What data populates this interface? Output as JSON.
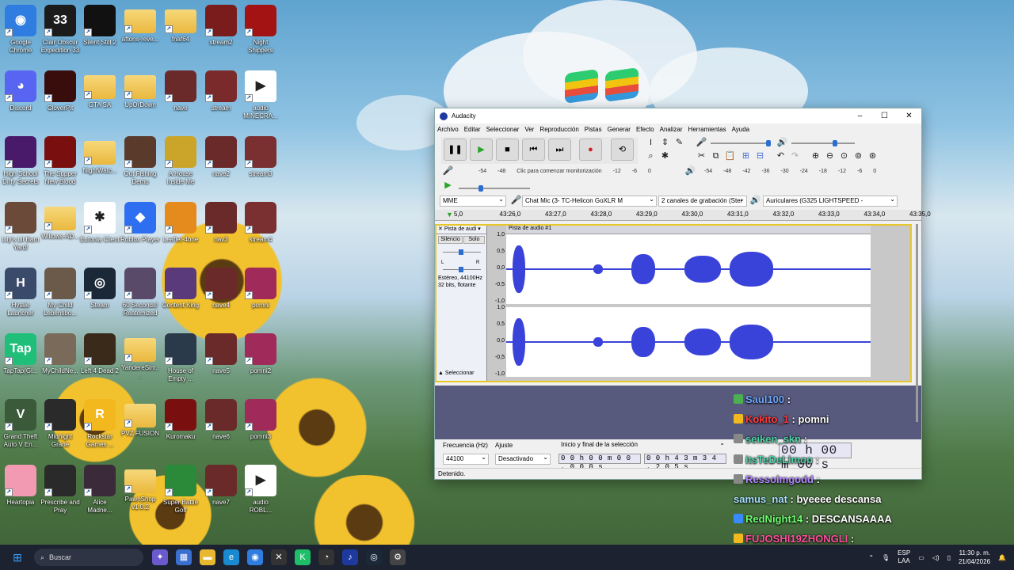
{
  "desktop": {
    "icons": [
      {
        "label": "Google Chrome",
        "color": "#2f7de1",
        "glyph": "◉"
      },
      {
        "label": "Clair Obscur Expedition 33",
        "color": "#1b1b1b",
        "glyph": "33"
      },
      {
        "label": "Silent Still 2",
        "color": "#111111",
        "glyph": ""
      },
      {
        "label": "aftons-reve...",
        "color": "folder",
        "glyph": ""
      },
      {
        "label": "fnaf64",
        "color": "folder",
        "glyph": ""
      },
      {
        "label": "stream2",
        "color": "#7a1c1c",
        "glyph": ""
      },
      {
        "label": "Night Shippers",
        "color": "#a31313",
        "glyph": ""
      },
      {
        "label": "Discord",
        "color": "#5865f2",
        "glyph": "◕"
      },
      {
        "label": "CloverPit",
        "color": "#3a0d0d",
        "glyph": ""
      },
      {
        "label": "GTA SA",
        "color": "folder",
        "glyph": ""
      },
      {
        "label": "UpOrDown",
        "color": "folder",
        "glyph": ""
      },
      {
        "label": "nave",
        "color": "#6b2a2a",
        "glyph": ""
      },
      {
        "label": "stream",
        "color": "#7a2a2a",
        "glyph": ""
      },
      {
        "label": "audio MINECRA...",
        "color": "#ffffff",
        "glyph": "▶"
      },
      {
        "label": "High School Dirty Secrets",
        "color": "#4a1a6a",
        "glyph": ""
      },
      {
        "label": "The Supper New Blood",
        "color": "#7a0f0f",
        "glyph": ""
      },
      {
        "label": "NightWatc...",
        "color": "folder",
        "glyph": ""
      },
      {
        "label": "Out Fishing Demo",
        "color": "#5a3a2a",
        "glyph": ""
      },
      {
        "label": "A House Inside Me",
        "color": "#caa52a",
        "glyph": ""
      },
      {
        "label": "nave2",
        "color": "#6b2a2a",
        "glyph": ""
      },
      {
        "label": "stream3",
        "color": "#7a3030",
        "glyph": ""
      },
      {
        "label": "Lily's Lil Barn Yard!",
        "color": "#6b4a3a",
        "glyph": ""
      },
      {
        "label": "Willows-AD...",
        "color": "folder",
        "glyph": ""
      },
      {
        "label": "Eufonia Client",
        "color": "#ffffff",
        "glyph": "✱"
      },
      {
        "label": "Roblox Player",
        "color": "#2e6ff2",
        "glyph": "◆"
      },
      {
        "label": "Leaflet-4one",
        "color": "#e58b1e",
        "glyph": ""
      },
      {
        "label": "nav3",
        "color": "#6b2a2a",
        "glyph": ""
      },
      {
        "label": "stream4",
        "color": "#7a3030",
        "glyph": ""
      },
      {
        "label": "Hytale Launcher",
        "color": "#3a4a6a",
        "glyph": "H"
      },
      {
        "label": "My Child Lebensbo...",
        "color": "#6b5a4a",
        "glyph": ""
      },
      {
        "label": "Steam",
        "color": "#1b2838",
        "glyph": "◎"
      },
      {
        "label": "60 Seconds! Reatomized",
        "color": "#5a4a6a",
        "glyph": ""
      },
      {
        "label": "Content King",
        "color": "#5a3a7a",
        "glyph": ""
      },
      {
        "label": "nave4",
        "color": "#6b2a2a",
        "glyph": ""
      },
      {
        "label": "pomni",
        "color": "#a02a5a",
        "glyph": ""
      },
      {
        "label": "TapTap(Gl...",
        "color": "#1fbf7a",
        "glyph": "Tap"
      },
      {
        "label": "MyChildNe...",
        "color": "#7a6a5a",
        "glyph": ""
      },
      {
        "label": "Left 4 Dead 2",
        "color": "#3a2a1a",
        "glyph": ""
      },
      {
        "label": "YandereSim...",
        "color": "folder",
        "glyph": ""
      },
      {
        "label": "House of Empty ...",
        "color": "#2a3a4a",
        "glyph": ""
      },
      {
        "label": "nave5",
        "color": "#6b2a2a",
        "glyph": ""
      },
      {
        "label": "pomni2",
        "color": "#a02a5a",
        "glyph": ""
      },
      {
        "label": "Grand Theft Auto V En...",
        "color": "#3a5a3a",
        "glyph": "V"
      },
      {
        "label": "Midnight Grane",
        "color": "#2a2a2a",
        "glyph": ""
      },
      {
        "label": "Rockstar Games ...",
        "color": "#f2b81e",
        "glyph": "R"
      },
      {
        "label": "PVZ FUSION",
        "color": "folder",
        "glyph": ""
      },
      {
        "label": "Kuromaku",
        "color": "#7a0f0f",
        "glyph": ""
      },
      {
        "label": "nave6",
        "color": "#6b2a2a",
        "glyph": ""
      },
      {
        "label": "pomni3",
        "color": "#a02a5a",
        "glyph": ""
      },
      {
        "label": "Heartopia",
        "color": "#f29ab2",
        "glyph": ""
      },
      {
        "label": "Prescribe and Pray",
        "color": "#2a2a2a",
        "glyph": ""
      },
      {
        "label": "Alice Madne...",
        "color": "#3a2a3a",
        "glyph": ""
      },
      {
        "label": "PawnShop v1.0.2",
        "color": "folder",
        "glyph": ""
      },
      {
        "label": "Super Battle Golf",
        "color": "#2a8a3a",
        "glyph": ""
      },
      {
        "label": "nave7",
        "color": "#6b2a2a",
        "glyph": ""
      },
      {
        "label": "audio ROBL...",
        "color": "#ffffff",
        "glyph": "▶"
      }
    ]
  },
  "window": {
    "title": "Audacity",
    "menus": [
      "Archivo",
      "Editar",
      "Seleccionar",
      "Ver",
      "Reproducción",
      "Pistas",
      "Generar",
      "Efecto",
      "Analizar",
      "Herramientas",
      "Ayuda"
    ],
    "rec_meter_ticks": [
      "-54",
      "-48",
      "-12",
      "-6",
      "0"
    ],
    "rec_meter_hint": "Clic para comenzar monitorización",
    "play_meter_ticks": [
      "-54",
      "-48",
      "-42",
      "-36",
      "-30",
      "-24",
      "-18",
      "-12",
      "-6",
      "0"
    ],
    "host": "MME",
    "rec_device": "Chat Mic (3- TC-Helicon GoXLR M",
    "channels": "2 canales de grabación (Ster",
    "play_device": "Auriculares (G325 LIGHTSPEED -",
    "ruler": [
      "5,0",
      "43:26,0",
      "43:27,0",
      "43:28,0",
      "43:29,0",
      "43:30,0",
      "43:31,0",
      "43:32,0",
      "43:33,0",
      "43:34,0",
      "43:35,0"
    ],
    "track": {
      "name": "Pista de audi",
      "clip": "Pista de audio #1",
      "mute": "Silencio",
      "solo": "Solo",
      "info1": "Estéreo, 44100Hz",
      "info2": "32 bits, flotante",
      "select": "Seleccionar",
      "gain_l": "L",
      "gain_r": "R",
      "vaxis": [
        "1,0",
        "0,5",
        "0,0",
        "-0,5",
        "-1,0"
      ]
    },
    "bottom": {
      "freq_label": "Frecuencia (Hz)",
      "freq": "44100",
      "snap_label": "Ajuste",
      "snap": "Desactivado",
      "sel_label": "Inicio y final de la selección",
      "start": "0 0 h 0 0 m 0 0 , 0 0 0 s",
      "end": "0 0 h 4 3 m 3 4 , 2 0 5 s",
      "bigtime": "00 h 00 m 00 s"
    },
    "status": "Detenido."
  },
  "chat": [
    {
      "user": "Saul100",
      "msg": "",
      "color": "#6fa8ff",
      "badge": "#4caf50"
    },
    {
      "user": "Kokito_1",
      "msg": "pomni",
      "color": "#ff3a3a",
      "badge": "#f2b81e"
    },
    {
      "user": "seiken_skn",
      "msg": "",
      "color": "#4dd0a8",
      "badge": "#888888"
    },
    {
      "user": "itsTeDeLimon",
      "msg": "",
      "color": "#4dd0a8",
      "badge": "#888888"
    },
    {
      "user": "Ressolmgodd",
      "msg": "",
      "color": "#b388ff",
      "badge": "#888888"
    },
    {
      "user": "samus_nat",
      "msg": "byeeee descansa",
      "color": "#a8e0ff",
      "badge": ""
    },
    {
      "user": "RedNight14",
      "msg": "DESCANSAAAA",
      "color": "#6fff6f",
      "badge": "#3a8aff"
    },
    {
      "user": "FUJOSHI19ZHONGLI",
      "msg": "",
      "color": "#ff4fa0",
      "badge": "#f2b81e"
    }
  ],
  "taskbar": {
    "search": "Buscar",
    "lang1": "ESP",
    "lang2": "LAA",
    "time": "11:30 p. m.",
    "date": "21/04/2026"
  }
}
